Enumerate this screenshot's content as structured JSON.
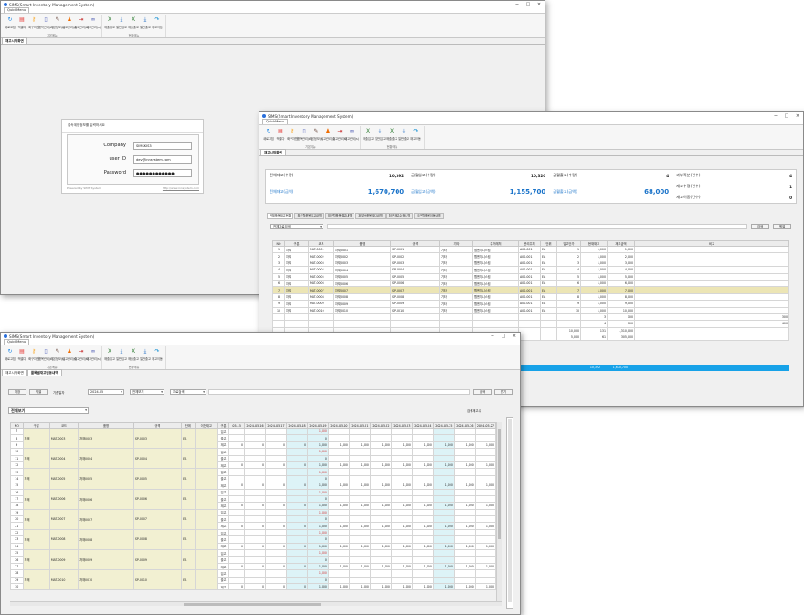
{
  "app": {
    "title": "SIMS(Smart Inventory Management System)",
    "quickmenu_tab": "QuickMenu"
  },
  "window_buttons": [
    "−",
    "□",
    "×"
  ],
  "ribbon": {
    "groups": [
      {
        "name": "기본메뉴",
        "buttons": [
          {
            "label": "새로고침",
            "icon": "refresh-icon",
            "color": "#1e88e5",
            "glyph": "↻"
          },
          {
            "label": "엑셀다",
            "icon": "excel-export-icon",
            "color": "#e53935",
            "glyph": "▤"
          },
          {
            "label": "화구자원",
            "icon": "key-icon",
            "color": "#f9a825",
            "glyph": "⚷"
          },
          {
            "label": "품목관리(s)",
            "icon": "document-icon",
            "color": "#5c6bc0",
            "glyph": "▯"
          },
          {
            "label": "기본정보(s)",
            "icon": "settings-icon",
            "color": "#6d4c41",
            "glyph": "✎"
          },
          {
            "label": "입고관리(s)",
            "icon": "users-icon",
            "color": "#ef6c00",
            "glyph": "♟"
          },
          {
            "label": "출고관리(s)",
            "icon": "export-icon",
            "color": "#c62828",
            "glyph": "⇥"
          },
          {
            "label": "재고관리(s)",
            "icon": "link-icon",
            "color": "#3949ab",
            "glyph": "∞"
          }
        ]
      },
      {
        "name": "현황메뉴",
        "buttons": [
          {
            "label": "매출입고",
            "icon": "excel-icon",
            "color": "#2e7d32",
            "glyph": "X"
          },
          {
            "label": "일반입고",
            "icon": "download-icon",
            "color": "#1565c0",
            "glyph": "⤓"
          },
          {
            "label": "매출출고",
            "icon": "excel-icon",
            "color": "#2e7d32",
            "glyph": "X"
          },
          {
            "label": "일반출고",
            "icon": "download-icon",
            "color": "#1565c0",
            "glyph": "⤓"
          },
          {
            "label": "재고이동",
            "icon": "share-icon",
            "color": "#0288d1",
            "glyph": "↷"
          }
        ]
      }
    ]
  },
  "win1": {
    "doc_tab": "재고시작화면"
  },
  "login": {
    "title": "접속계정정보를 입력하세요",
    "company_label": "Company",
    "company_value": "SIMSKIS3",
    "userid_label": "user ID",
    "userid_value": "dev@innsystem.com",
    "password_label": "Password",
    "password_value": "●●●●●●●●●●●●",
    "footer_left": "Powered by SIMS System",
    "footer_right": "http://www.innsystem.com"
  },
  "win2": {
    "doc_tab": "재고시작화면",
    "summary": [
      {
        "label": "전체재고(수량)",
        "value": "10,392"
      },
      {
        "label": "금월입고(수량)",
        "value": "10,320"
      },
      {
        "label": "금월출고(수량)",
        "value": "4"
      },
      {
        "label": "과부족분(건수)",
        "value": "4"
      },
      {
        "label": "전체재고(금액)",
        "value": "1,670,700"
      },
      {
        "label": "금월입고(금액)",
        "value": "1,155,700"
      },
      {
        "label": "금월출고(금액)",
        "value": "68,000"
      },
      {
        "label": "재고수정(건수)",
        "value": "1"
      },
      {
        "label": "재고이동(건수)",
        "value": "0"
      }
    ],
    "subtabs": [
      "전체품목재고현황",
      "최근월품목입고내역",
      "최근월품목출고내역",
      "과부족품목재고내역",
      "최근재고수정내역",
      "최근월품목이동내역"
    ],
    "filter": "전체자료검색",
    "search_btn": "검색",
    "excel_btn": "엑셀",
    "columns": [
      "NO",
      "구분",
      "코드",
      "품명",
      "규격",
      "기타",
      "주거래처",
      "관리주체",
      "단위",
      "입고단가",
      "현재재고",
      "재고금액",
      "비고"
    ],
    "rows": [
      [
        "1",
        "자재",
        "MAT-0001",
        "자재0001",
        "SP-0001",
        "기타",
        "웹엔지니스컴",
        "A00-001",
        "EA",
        "1",
        "1,000",
        "1,000",
        ""
      ],
      [
        "2",
        "자재",
        "MAT-0002",
        "자재0002",
        "SP-0002",
        "기타",
        "웹엔지니스컴",
        "A00-001",
        "EA",
        "2",
        "1,000",
        "2,000",
        ""
      ],
      [
        "3",
        "자재",
        "MAT-0003",
        "자재0003",
        "SP-0003",
        "기타",
        "웹엔지니스컴",
        "A00-001",
        "EA",
        "3",
        "1,000",
        "3,000",
        ""
      ],
      [
        "4",
        "자재",
        "MAT-0004",
        "자재0004",
        "SP-0004",
        "기타",
        "웹엔지니스컴",
        "A00-001",
        "EA",
        "4",
        "1,000",
        "4,000",
        ""
      ],
      [
        "5",
        "자재",
        "MAT-0005",
        "자재0005",
        "SP-0005",
        "기타",
        "웹엔지니스컴",
        "A00-001",
        "EA",
        "5",
        "1,000",
        "5,000",
        ""
      ],
      [
        "6",
        "자재",
        "MAT-0006",
        "자재0006",
        "SP-0006",
        "기타",
        "웹엔지니스컴",
        "A00-001",
        "EA",
        "6",
        "1,000",
        "6,000",
        ""
      ],
      [
        "7",
        "자재",
        "MAT-0007",
        "자재0007",
        "SP-0007",
        "기타",
        "웹엔지니스컴",
        "A00-001",
        "EA",
        "7",
        "1,000",
        "7,000",
        ""
      ],
      [
        "8",
        "자재",
        "MAT-0008",
        "자재0008",
        "SP-0008",
        "기타",
        "웹엔지니스컴",
        "A00-001",
        "EA",
        "8",
        "1,000",
        "8,000",
        ""
      ],
      [
        "9",
        "자재",
        "MAT-0009",
        "자재0009",
        "SP-0009",
        "기타",
        "웹엔지니스컴",
        "A00-001",
        "EA",
        "9",
        "1,000",
        "9,000",
        ""
      ],
      [
        "10",
        "자재",
        "MAT-0010",
        "자재0010",
        "SP-0010",
        "기타",
        "웹엔지니스컴",
        "A00-001",
        "EA",
        "10",
        "1,000",
        "10,000",
        ""
      ]
    ],
    "extra_rows": [
      [
        "",
        "",
        "3",
        "100",
        "300"
      ],
      [
        "",
        "",
        "4",
        "100",
        "400"
      ],
      [
        "",
        "10,000",
        "131",
        "1,310,000",
        ""
      ],
      [
        "",
        "5,000",
        "61",
        "305,000",
        ""
      ]
    ],
    "total_row": [
      "10,392",
      "1,670,700"
    ]
  },
  "win3": {
    "doc_tabs": [
      "재고시작화면",
      "품목별재고변동내역"
    ],
    "new_btn": "저장",
    "excel_btn": "엑셀",
    "period_label": "기준일자",
    "date_value": "2024-05",
    "all_select": "전체보기",
    "mode_select": "자료검색",
    "search_btn": "검색",
    "close_btn": "닫기",
    "view_select": "전체보기",
    "right_label": "검색재고수",
    "columns": [
      "NO",
      "구분",
      "코드",
      "품명",
      "규격",
      "단위",
      "이전재고",
      "구분",
      "05-15",
      "2024-05-16",
      "2024-05-17",
      "2024-05-18",
      "2024-05-19",
      "2024-05-20",
      "2024-05-21",
      "2024-05-22",
      "2024-05-23",
      "2024-05-24",
      "2024-05-25",
      "2024-05-26",
      "2024-05-27"
    ],
    "items": [
      {
        "nos": [
          "7",
          "8",
          "9"
        ],
        "cat": "자재",
        "code": "MAT-0003",
        "name": "자재0003",
        "spec": "SP-0003",
        "unit": "EA"
      },
      {
        "nos": [
          "10",
          "11",
          "12"
        ],
        "cat": "자재",
        "code": "MAT-0004",
        "name": "자재0004",
        "spec": "SP-0004",
        "unit": "EA"
      },
      {
        "nos": [
          "13",
          "14",
          "15"
        ],
        "cat": "자재",
        "code": "MAT-0005",
        "name": "자재0005",
        "spec": "SP-0005",
        "unit": "EA"
      },
      {
        "nos": [
          "16",
          "17",
          "18"
        ],
        "cat": "자재",
        "code": "MAT-0006",
        "name": "자재0006",
        "spec": "SP-0006",
        "unit": "EA"
      },
      {
        "nos": [
          "19",
          "20",
          "21"
        ],
        "cat": "자재",
        "code": "MAT-0007",
        "name": "자재0007",
        "spec": "SP-0007",
        "unit": "EA"
      },
      {
        "nos": [
          "22",
          "23",
          "24"
        ],
        "cat": "자재",
        "code": "MAT-0008",
        "name": "자재0008",
        "spec": "SP-0008",
        "unit": "EA"
      },
      {
        "nos": [
          "25",
          "26",
          "27"
        ],
        "cat": "자재",
        "code": "MAT-0009",
        "name": "자재0009",
        "spec": "SP-0009",
        "unit": "EA"
      },
      {
        "nos": [
          "28",
          "29",
          "30"
        ],
        "cat": "자재",
        "code": "MAT-0010",
        "name": "자재0010",
        "spec": "SP-0010",
        "unit": "EA"
      }
    ],
    "sub_labels": [
      "입고",
      "출고",
      "재고"
    ],
    "in_value": "1,000",
    "zero": "0",
    "stock_value": "1,000"
  }
}
